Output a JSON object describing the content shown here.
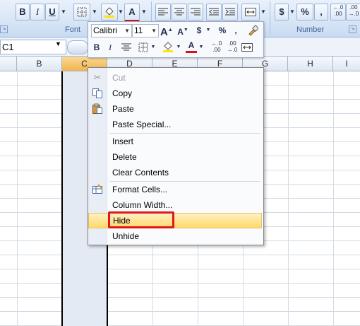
{
  "ribbon": {
    "font_group_label": "Font",
    "number_group_label": "Number",
    "bold": "B",
    "italic": "I",
    "underline": "U",
    "font_color": "A",
    "currency": "$",
    "percent": "%",
    "comma": ",",
    "inc_decimal": "←.0\n.00",
    "dec_decimal": ".00\n→.0"
  },
  "formula_bar": {
    "name_box": "C1"
  },
  "columns": [
    "B",
    "C",
    "D",
    "E",
    "F",
    "G",
    "H",
    "I"
  ],
  "mini_toolbar": {
    "font": "Calibri",
    "size": "11",
    "bold": "B",
    "italic": "I",
    "currency": "$",
    "percent": "%",
    "comma": ",",
    "font_color": "A",
    "grow_font": "A",
    "shrink_font": "A"
  },
  "context_menu": {
    "items": [
      {
        "label": "Cut",
        "icon": "scissors-icon",
        "disabled": true
      },
      {
        "label": "Copy",
        "icon": "copy-icon"
      },
      {
        "label": "Paste",
        "icon": "paste-icon"
      },
      {
        "label": "Paste Special..."
      },
      {
        "label": "Insert"
      },
      {
        "label": "Delete"
      },
      {
        "label": "Clear Contents"
      },
      {
        "label": "Format Cells...",
        "icon": "format-cells-icon"
      },
      {
        "label": "Column Width..."
      },
      {
        "label": "Hide",
        "highlighted": true
      },
      {
        "label": "Unhide"
      }
    ]
  },
  "colors": {
    "highlight_outline": "#e2161b",
    "menu_highlight": "#ffd86a",
    "ribbon_bg": "#d9e6f6"
  }
}
